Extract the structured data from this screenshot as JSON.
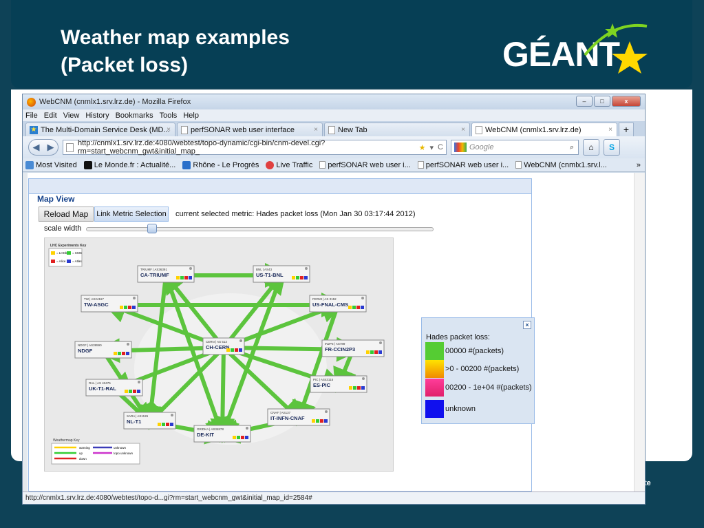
{
  "slide": {
    "title_line1": "Weather map examples",
    "title_line2": "(Packet loss)",
    "logo_text": "GÉANT",
    "corner_text": "te"
  },
  "window": {
    "title": "WebCNM (cnmlx1.srv.lrz.de) - Mozilla Firefox",
    "min": "–",
    "max": "□",
    "close": "x"
  },
  "menu": [
    "File",
    "Edit",
    "View",
    "History",
    "Bookmarks",
    "Tools",
    "Help"
  ],
  "tabs": [
    {
      "label": "The Multi-Domain Service Desk (MD..."
    },
    {
      "label": "perfSONAR web user interface"
    },
    {
      "label": "New Tab"
    },
    {
      "label": "WebCNM (cnmlx1.srv.lrz.de)"
    }
  ],
  "nav": {
    "url": "http://cnmlx1.srv.lrz.de:4080/webtest/topo-dynamic/cgi-bin/cnm-devel.cgi?rm=start_webcnm_gwt&initial_map_",
    "search_placeholder": "Google"
  },
  "bookmarks": [
    {
      "label": "Most Visited"
    },
    {
      "label": "Le Monde.fr : Actualité..."
    },
    {
      "label": "Rhône - Le Progrès"
    },
    {
      "label": "Live Traffic"
    },
    {
      "label": "perfSONAR web user i..."
    },
    {
      "label": "perfSONAR web user i..."
    },
    {
      "label": "WebCNM (cnmlx1.srv.l..."
    }
  ],
  "panel": {
    "title": "Map View",
    "reload": "Reload Map",
    "link_metric": "Link Metric Selection",
    "metric_text": "current selected metric: Hades packet loss (Mon Jan 30 03:17:44 2012)",
    "scale": "scale width",
    "scale_level": 0.19
  },
  "map": {
    "exp_key_title": "LHC Experiments Key",
    "exp_key": [
      "= LHCb",
      "= CMS",
      "= Alice",
      "= Atlas"
    ],
    "nodes": [
      {
        "id": "triumf",
        "sub": "TRIUMF | AS36391",
        "name": "CA-TRIUMF"
      },
      {
        "id": "bnl",
        "sub": "BNL | AS43",
        "name": "US-T1-BNL"
      },
      {
        "id": "tw",
        "sub": "TW | AS24167",
        "name": "TW-ASGC"
      },
      {
        "id": "fermi",
        "sub": "FERMI | AS 3152",
        "name": "US-FNAL-CMS"
      },
      {
        "id": "ndgf",
        "sub": "NDGF | AS39590",
        "name": "NDGF"
      },
      {
        "id": "cern",
        "sub": "CERN | AS 513",
        "name": "CH-CERN"
      },
      {
        "id": "in2p3",
        "sub": "IN2P3 | AS789",
        "name": "FR-CCIN2P3"
      },
      {
        "id": "ral",
        "sub": "RAL | AS 43475",
        "name": "UK-T1-RAL"
      },
      {
        "id": "pic",
        "sub": "PIC | AS43115",
        "name": "ES-PIC"
      },
      {
        "id": "cnaf",
        "sub": "CNAF | AS137",
        "name": "IT-INFN-CNAF"
      },
      {
        "id": "sara",
        "sub": "SARA | AS1126",
        "name": "NL-T1"
      },
      {
        "id": "gridka",
        "sub": "GRIDKA | AS34878",
        "name": "DE-KIT"
      }
    ],
    "wm_key_title": "Weathermap Key",
    "wm_key": [
      {
        "label": "warning",
        "color": "#ffd200"
      },
      {
        "label": "unknown",
        "color": "#3b3bb8"
      },
      {
        "label": "up",
        "color": "#33cc33"
      },
      {
        "label": "topo unknown",
        "color": "#cc33cc"
      },
      {
        "label": "down",
        "color": "#e02020"
      }
    ]
  },
  "legend": {
    "title": "Hades packet loss:",
    "close": "×",
    "rows": [
      {
        "label": "00000 #(packets)",
        "color": "#55cc33"
      },
      {
        "label": ">0 - 00200 #(packets)",
        "color": "#f6b000"
      },
      {
        "label": "00200 - 1e+04 #(packets)",
        "color": "#f0208a"
      },
      {
        "label": "unknown",
        "color": "#1010ee"
      }
    ]
  },
  "status_url": "http://cnmlx1.srv.lrz.de:4080/webtest/topo-d...gi?rm=start_webcnm_gwt&initial_map_id=2584#"
}
